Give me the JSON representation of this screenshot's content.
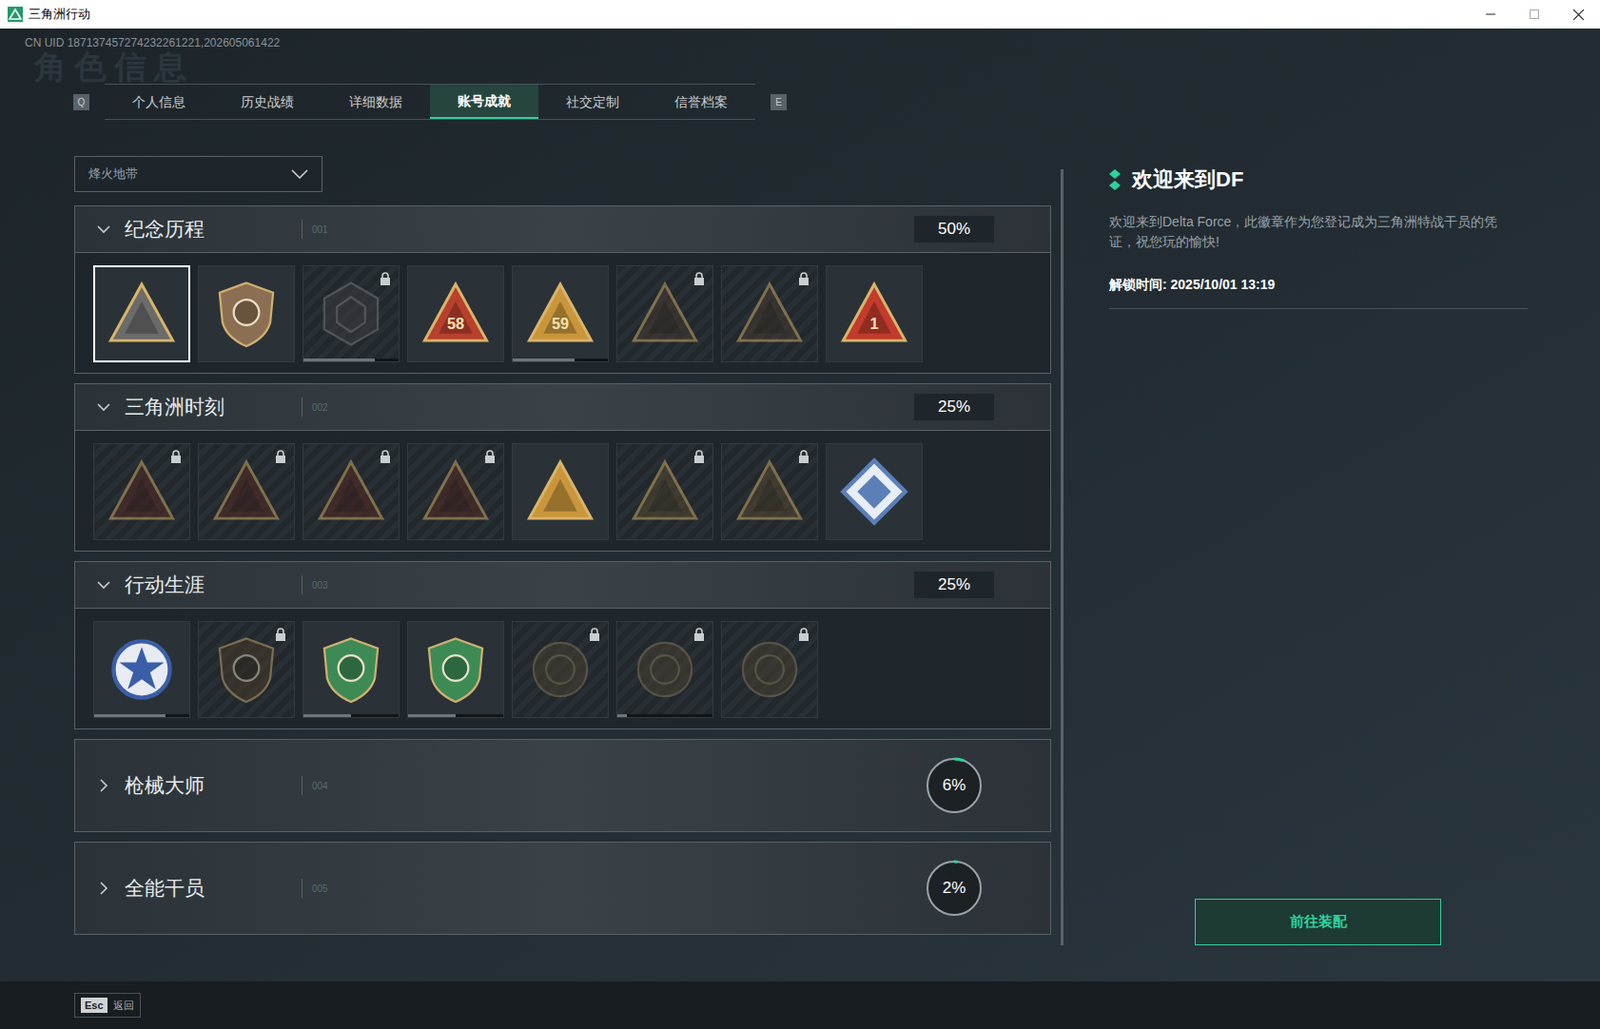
{
  "window": {
    "title": "三角洲行动"
  },
  "uid": "CN UID 187137457274232261221,202605061422",
  "watermark": "角色信息",
  "tabs": {
    "prev_key": "Q",
    "next_key": "E",
    "items": [
      {
        "label": "个人信息",
        "selected": false
      },
      {
        "label": "历史战绩",
        "selected": false
      },
      {
        "label": "详细数据",
        "selected": false
      },
      {
        "label": "账号成就",
        "selected": true
      },
      {
        "label": "社交定制",
        "selected": false
      },
      {
        "label": "信誉档案",
        "selected": false
      }
    ]
  },
  "mode_dropdown": {
    "value": "烽火地带"
  },
  "sections": [
    {
      "title": "纪念历程",
      "number": "001",
      "percent": "50%",
      "expanded": true,
      "badges": [
        {
          "kind": "triangle",
          "color": "#6b6b6b",
          "locked": false,
          "selected": true
        },
        {
          "kind": "shield",
          "color": "#8c6f52",
          "locked": false,
          "selected": false
        },
        {
          "kind": "hexagon",
          "color": "#3a3d40",
          "locked": true,
          "selected": false,
          "level": 0.75
        },
        {
          "kind": "triangle",
          "color": "#b8402e",
          "locked": false,
          "selected": false,
          "label": "58"
        },
        {
          "kind": "triangle",
          "color": "#c9963c",
          "locked": false,
          "selected": false,
          "label": "59",
          "level": 0.65
        },
        {
          "kind": "triangle",
          "color": "#4a3a30",
          "locked": true,
          "selected": false
        },
        {
          "kind": "triangle",
          "color": "#4a3a30",
          "locked": true,
          "selected": false
        },
        {
          "kind": "triangle",
          "color": "#c23b2c",
          "locked": false,
          "selected": false,
          "label": "1"
        }
      ]
    },
    {
      "title": "三角洲时刻",
      "number": "002",
      "percent": "25%",
      "expanded": true,
      "badges": [
        {
          "kind": "triangle",
          "color": "#5a2a24",
          "locked": true,
          "selected": false
        },
        {
          "kind": "triangle",
          "color": "#5a2a24",
          "locked": true,
          "selected": false
        },
        {
          "kind": "triangle",
          "color": "#5a2a24",
          "locked": true,
          "selected": false
        },
        {
          "kind": "triangle",
          "color": "#5a2a24",
          "locked": true,
          "selected": false
        },
        {
          "kind": "triangle",
          "color": "#c9963c",
          "locked": false,
          "selected": false
        },
        {
          "kind": "triangle",
          "color": "#5a4a30",
          "locked": true,
          "selected": false
        },
        {
          "kind": "triangle",
          "color": "#5a4a30",
          "locked": true,
          "selected": false
        },
        {
          "kind": "diamond",
          "color": "#5c7fb8",
          "locked": false,
          "selected": false
        }
      ]
    },
    {
      "title": "行动生涯",
      "number": "003",
      "percent": "25%",
      "expanded": true,
      "badges": [
        {
          "kind": "star",
          "color": "#3b5ea8",
          "locked": false,
          "selected": false,
          "level": 0.75
        },
        {
          "kind": "shield",
          "color": "#4a3a2a",
          "locked": true,
          "selected": false
        },
        {
          "kind": "shield",
          "color": "#3d8a55",
          "locked": false,
          "selected": false,
          "level": 0.5
        },
        {
          "kind": "shield",
          "color": "#3d8a55",
          "locked": false,
          "selected": false,
          "level": 0.5
        },
        {
          "kind": "medal",
          "color": "#4a4030",
          "locked": true,
          "selected": false
        },
        {
          "kind": "medal",
          "color": "#4a4030",
          "locked": true,
          "selected": false,
          "level": 0.1
        },
        {
          "kind": "medal",
          "color": "#4a4030",
          "locked": true,
          "selected": false
        }
      ]
    },
    {
      "title": "枪械大师",
      "number": "004",
      "percent": "6%",
      "expanded": false,
      "level": 0.06,
      "badges": []
    },
    {
      "title": "全能干员",
      "number": "005",
      "percent": "2%",
      "expanded": false,
      "level": 0.02,
      "badges": []
    }
  ],
  "detail": {
    "title": "欢迎来到DF",
    "description": "欢迎来到Delta Force，此徽章作为您登记成为三角洲特战干员的凭证，祝您玩的愉快!",
    "unlock_time": "解锁时间: 2025/10/01 13:19",
    "button": "前往装配"
  },
  "footer": {
    "key": "Esc",
    "label": "返回"
  }
}
